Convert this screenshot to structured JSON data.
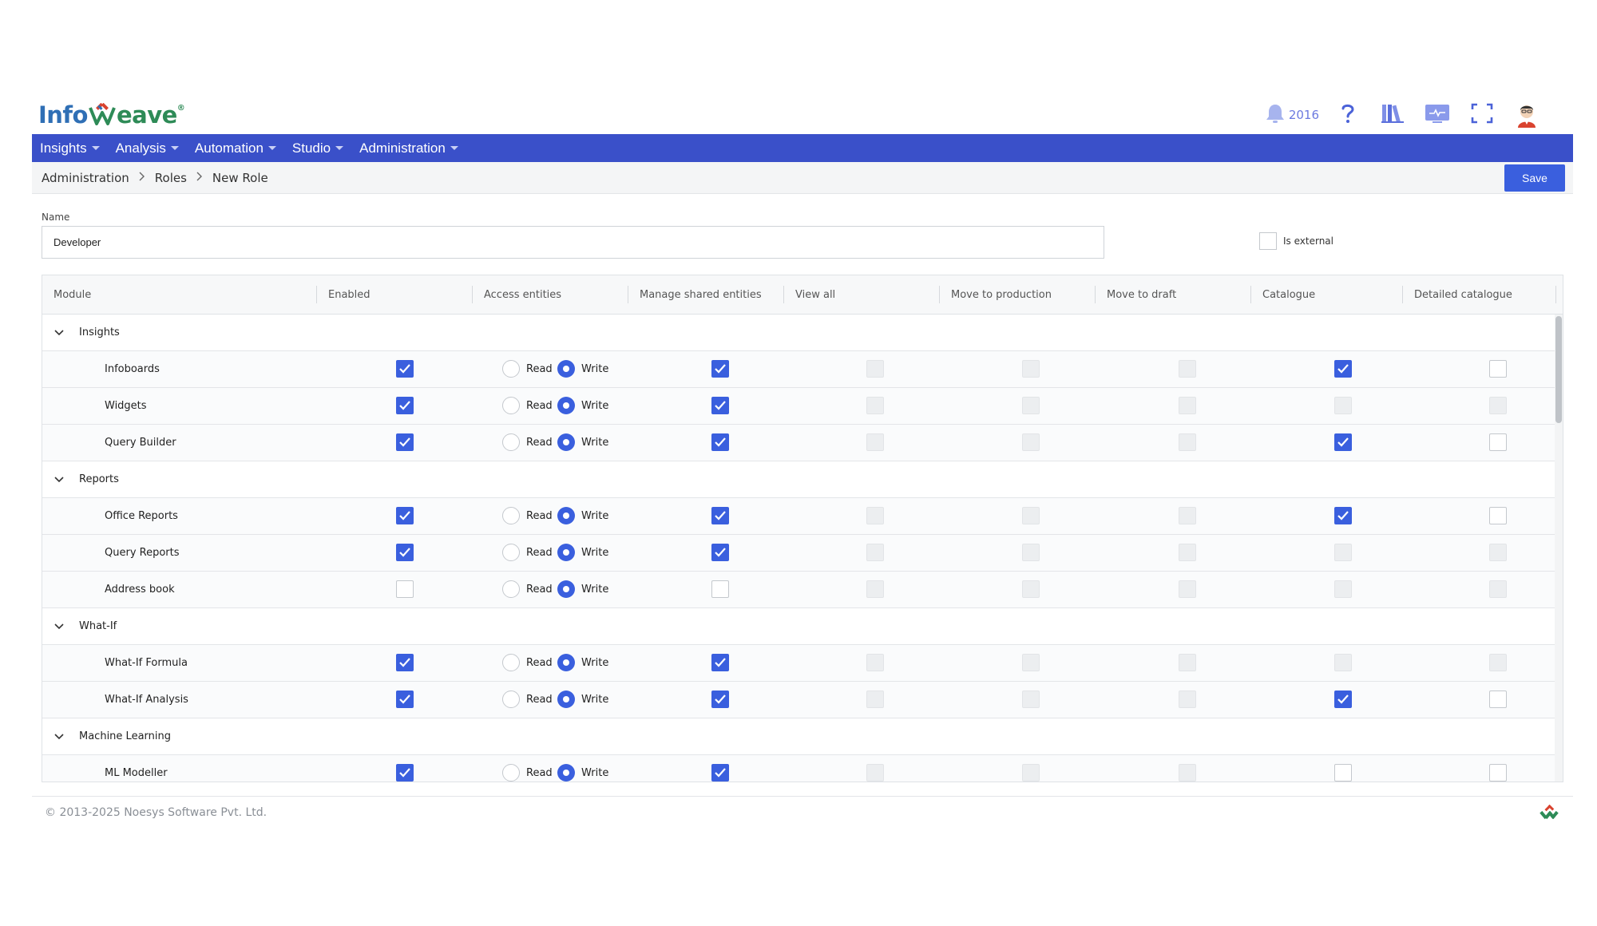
{
  "brand": {
    "name": "Infoweave",
    "text_left": "Info",
    "text_right": "eave",
    "trademark": "®"
  },
  "header": {
    "notification_count": "2016",
    "icons": [
      "bell-icon",
      "help-icon",
      "library-icon",
      "monitor-icon",
      "fullscreen-icon",
      "user-avatar"
    ]
  },
  "nav": {
    "items": [
      {
        "label": "Insights"
      },
      {
        "label": "Analysis"
      },
      {
        "label": "Automation"
      },
      {
        "label": "Studio"
      },
      {
        "label": "Administration"
      }
    ]
  },
  "breadcrumb": {
    "items": [
      "Administration",
      "Roles",
      "New Role"
    ]
  },
  "toolbar": {
    "save_label": "Save"
  },
  "form": {
    "name_label": "Name",
    "name_value": "Developer",
    "is_external_label": "Is external",
    "is_external_checked": false
  },
  "table": {
    "columns": [
      "Module",
      "Enabled",
      "Access entities",
      "Manage shared entities",
      "View all",
      "Move to production",
      "Move to draft",
      "Catalogue",
      "Detailed catalogue"
    ],
    "radio_labels": {
      "read": "Read",
      "write": "Write"
    },
    "groups": [
      {
        "label": "Insights",
        "expanded": true,
        "items": [
          {
            "module": "Infoboards",
            "enabled": true,
            "access": "write",
            "manage_shared": true,
            "view_all": "disabled",
            "move_to_production": "disabled",
            "move_to_draft": "disabled",
            "catalogue": "checked",
            "detailed_catalogue": "unchecked"
          },
          {
            "module": "Widgets",
            "enabled": true,
            "access": "write",
            "manage_shared": true,
            "view_all": "disabled",
            "move_to_production": "disabled",
            "move_to_draft": "disabled",
            "catalogue": "disabled",
            "detailed_catalogue": "disabled"
          },
          {
            "module": "Query Builder",
            "enabled": true,
            "access": "write",
            "manage_shared": true,
            "view_all": "disabled",
            "move_to_production": "disabled",
            "move_to_draft": "disabled",
            "catalogue": "checked",
            "detailed_catalogue": "unchecked"
          }
        ]
      },
      {
        "label": "Reports",
        "expanded": true,
        "items": [
          {
            "module": "Office Reports",
            "enabled": true,
            "access": "write",
            "manage_shared": true,
            "view_all": "disabled",
            "move_to_production": "disabled",
            "move_to_draft": "disabled",
            "catalogue": "checked",
            "detailed_catalogue": "unchecked"
          },
          {
            "module": "Query Reports",
            "enabled": true,
            "access": "write",
            "manage_shared": true,
            "view_all": "disabled",
            "move_to_production": "disabled",
            "move_to_draft": "disabled",
            "catalogue": "disabled",
            "detailed_catalogue": "disabled"
          },
          {
            "module": "Address book",
            "enabled": false,
            "access": "write",
            "manage_shared": false,
            "view_all": "disabled",
            "move_to_production": "disabled",
            "move_to_draft": "disabled",
            "catalogue": "disabled",
            "detailed_catalogue": "disabled"
          }
        ]
      },
      {
        "label": "What-If",
        "expanded": true,
        "items": [
          {
            "module": "What-If Formula",
            "enabled": true,
            "access": "write",
            "manage_shared": true,
            "view_all": "disabled",
            "move_to_production": "disabled",
            "move_to_draft": "disabled",
            "catalogue": "disabled",
            "detailed_catalogue": "disabled"
          },
          {
            "module": "What-If Analysis",
            "enabled": true,
            "access": "write",
            "manage_shared": true,
            "view_all": "disabled",
            "move_to_production": "disabled",
            "move_to_draft": "disabled",
            "catalogue": "checked",
            "detailed_catalogue": "unchecked"
          }
        ]
      },
      {
        "label": "Machine Learning",
        "expanded": true,
        "items": [
          {
            "module": "ML Modeller",
            "enabled": true,
            "access": "write",
            "manage_shared": true,
            "view_all": "disabled",
            "move_to_production": "disabled",
            "move_to_draft": "disabled",
            "catalogue": "unchecked",
            "detailed_catalogue": "unchecked"
          }
        ]
      }
    ]
  },
  "footer": {
    "copyright": "© 2013-2025 Noesys Software Pvt. Ltd."
  },
  "colors": {
    "primary": "#3a50c9",
    "accent": "#3a5fde",
    "logo_blue": "#2f6fb5",
    "logo_green": "#2e8b57",
    "logo_red": "#d9432f"
  }
}
